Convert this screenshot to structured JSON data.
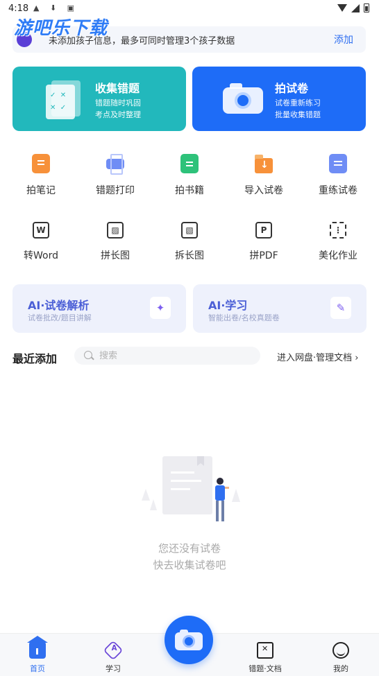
{
  "status_bar": {
    "time": "4:18"
  },
  "watermark": {
    "text": "游吧乐下载"
  },
  "notice": {
    "text": "未添加孩子信息，最多可同时管理3个孩子数据",
    "action": "添加"
  },
  "hero_cards": {
    "collect": {
      "title": "收集错题",
      "line1": "错题随时巩固",
      "line2": "考点及时整理"
    },
    "photo": {
      "title": "拍试卷",
      "line1": "试卷重新练习",
      "line2": "批量收集错题"
    }
  },
  "tools": [
    {
      "label": "拍笔记",
      "icon": "notebook-icon"
    },
    {
      "label": "错题打印",
      "icon": "printer-icon"
    },
    {
      "label": "拍书籍",
      "icon": "book-icon"
    },
    {
      "label": "导入试卷",
      "icon": "folder-import-icon"
    },
    {
      "label": "重练试卷",
      "icon": "paper-retry-icon"
    },
    {
      "label": "转Word",
      "icon": "word-icon",
      "glyph": "W"
    },
    {
      "label": "拼长图",
      "icon": "image-stitch-icon",
      "glyph": "▨"
    },
    {
      "label": "拆长图",
      "icon": "image-split-icon",
      "glyph": "▧"
    },
    {
      "label": "拼PDF",
      "icon": "pdf-icon",
      "glyph": "P"
    },
    {
      "label": "美化作业",
      "icon": "beautify-icon",
      "glyph": "⋮"
    }
  ],
  "ai_cards": {
    "analysis": {
      "title": "AI·试卷解析",
      "subtitle": "试卷批改/题目讲解"
    },
    "study": {
      "title": "AI·学习",
      "subtitle": "智能出卷/名校真题卷"
    }
  },
  "recent": {
    "title": "最近添加",
    "search_placeholder": "搜索",
    "netdisk_link": "进入网盘·管理文档"
  },
  "empty_state": {
    "line1": "您还没有试卷",
    "line2": "快去收集试卷吧"
  },
  "bottom_nav": {
    "home": "首页",
    "learn": "学习",
    "mistakes": "错题·文档",
    "me": "我的"
  },
  "colors": {
    "teal": "#22b8bc",
    "blue": "#1e6cf7",
    "accent": "#2f6ff0",
    "ai_text": "#4b5fd6"
  }
}
